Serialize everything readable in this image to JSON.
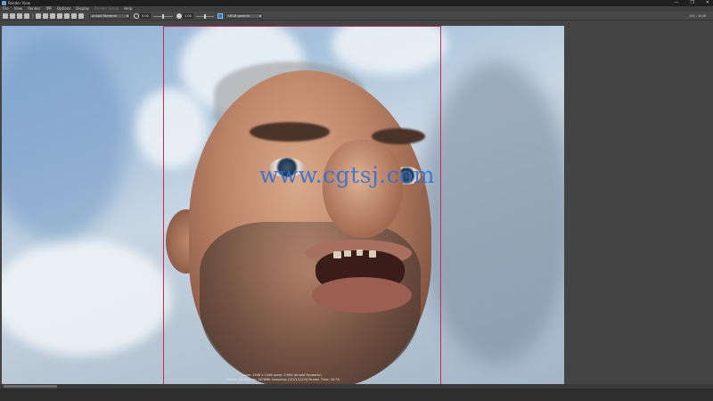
{
  "window": {
    "title": "Render View",
    "controls": {
      "minimize": "—",
      "maximize": "❐",
      "close": "✕"
    }
  },
  "menu": {
    "items": [
      {
        "label": "File",
        "enabled": true
      },
      {
        "label": "View",
        "enabled": true
      },
      {
        "label": "Render",
        "enabled": true
      },
      {
        "label": "IPR",
        "enabled": true
      },
      {
        "label": "Options",
        "enabled": true
      },
      {
        "label": "Display",
        "enabled": true
      },
      {
        "label": "Render Setup",
        "enabled": false
      },
      {
        "label": "Help",
        "enabled": true
      }
    ]
  },
  "toolbar": {
    "camera_dropdown": "Arnold Renderer",
    "exposure_value": "0.00",
    "gamma_value": "1.00",
    "colorspace_dropdown": "sRGB gamma",
    "resolution_label": "100 : 1048"
  },
  "render": {
    "watermark": "www.cgtsj.com",
    "info_line1": "size: 1048 x 1048  zoom: 0.900     (Arnold Renderer)",
    "info_line2": "Frame: 10    Memory: 2678Mb    Sampling: [3/1/1/1/2/0]    Render Time: 10:33"
  },
  "icons": [
    "app-icon",
    "render-icon",
    "snapshot-icon",
    "keep-image-icon",
    "exposure-icon",
    "gamma-icon",
    "color-management-icon"
  ]
}
